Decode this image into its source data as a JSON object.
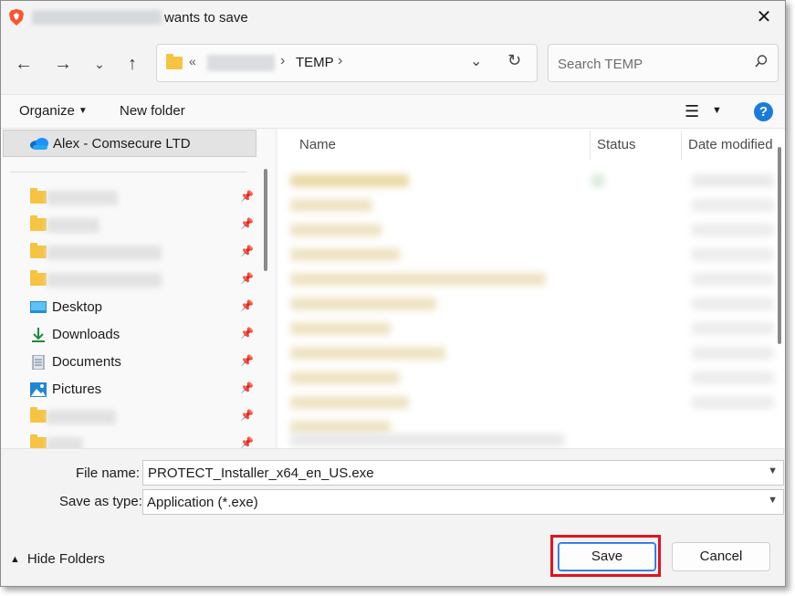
{
  "titlebar": {
    "title_suffix": "wants to save",
    "close_icon": "close-icon",
    "brand_color": "#fb542b"
  },
  "navigation": {
    "back_icon": "back-arrow-icon",
    "forward_icon": "forward-arrow-icon",
    "recent_icon": "chevron-down-icon",
    "up_icon": "up-arrow-icon",
    "breadcrumb_prefix": "«",
    "breadcrumb_current": "TEMP",
    "search_placeholder": "Search TEMP"
  },
  "commandbar": {
    "organize": "Organize",
    "new_folder": "New folder",
    "help": "?"
  },
  "navpane": {
    "onedrive_label": "Alex - Comsecure LTD",
    "items": [
      {
        "type": "folder",
        "label": "",
        "pinned": true
      },
      {
        "type": "folder",
        "label": "",
        "pinned": true
      },
      {
        "type": "folder",
        "label": "",
        "pinned": true
      },
      {
        "type": "folder",
        "label": "",
        "pinned": true
      },
      {
        "type": "desktop",
        "label": "Desktop",
        "pinned": true
      },
      {
        "type": "downloads",
        "label": "Downloads",
        "pinned": true
      },
      {
        "type": "documents",
        "label": "Documents",
        "pinned": true
      },
      {
        "type": "pictures",
        "label": "Pictures",
        "pinned": true
      },
      {
        "type": "folder",
        "label": "",
        "pinned": true
      }
    ]
  },
  "filelist": {
    "columns": [
      "Name",
      "Status",
      "Date modified"
    ]
  },
  "form": {
    "file_name_label": "File name:",
    "file_name_value": "PROTECT_Installer_x64_en_US.exe",
    "save_as_type_label": "Save as type:",
    "save_as_type_value": "Application (*.exe)"
  },
  "footer": {
    "hide_folders": "Hide Folders",
    "save": "Save",
    "cancel": "Cancel"
  },
  "colors": {
    "accent": "#1a7cd8",
    "highlight": "#e0141e",
    "folder": "#f6c343"
  }
}
